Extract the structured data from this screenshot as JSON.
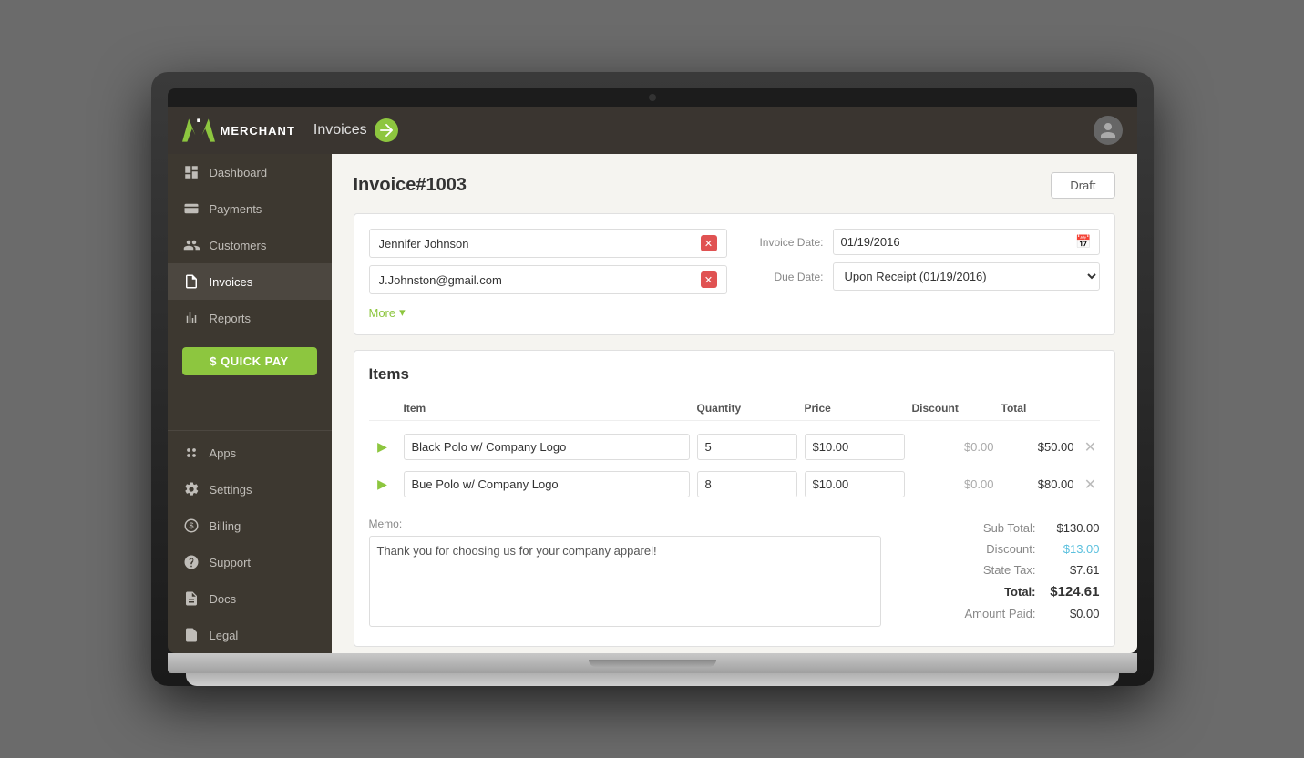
{
  "app": {
    "brand": "MERCHANT",
    "title": "Invoices"
  },
  "nav": {
    "items": [
      {
        "id": "dashboard",
        "label": "Dashboard"
      },
      {
        "id": "payments",
        "label": "Payments"
      },
      {
        "id": "customers",
        "label": "Customers"
      },
      {
        "id": "invoices",
        "label": "Invoices",
        "active": true
      },
      {
        "id": "reports",
        "label": "Reports"
      }
    ],
    "bottom_items": [
      {
        "id": "apps",
        "label": "Apps"
      },
      {
        "id": "settings",
        "label": "Settings"
      },
      {
        "id": "billing",
        "label": "Billing"
      },
      {
        "id": "support",
        "label": "Support"
      },
      {
        "id": "docs",
        "label": "Docs"
      },
      {
        "id": "legal",
        "label": "Legal"
      }
    ],
    "quick_pay_label": "$ QUICK PAY"
  },
  "invoice": {
    "title": "Invoice#1003",
    "draft_label": "Draft",
    "customer_name": "Jennifer Johnson",
    "customer_email": "J.Johnston@gmail.com",
    "invoice_date_label": "Invoice Date:",
    "invoice_date": "01/19/2016",
    "due_date_label": "Due Date:",
    "due_date": "Upon Receipt (01/19/2016)",
    "more_label": "More"
  },
  "items": {
    "section_title": "Items",
    "columns": {
      "item": "Item",
      "quantity": "Quantity",
      "price": "Price",
      "discount": "Discount",
      "total": "Total"
    },
    "rows": [
      {
        "name": "Black Polo w/ Company Logo",
        "quantity": "5",
        "price": "$10.00",
        "discount": "$0.00",
        "total": "$50.00"
      },
      {
        "name": "Bue Polo w/ Company Logo",
        "quantity": "8",
        "price": "$10.00",
        "discount": "$0.00",
        "total": "$80.00"
      }
    ]
  },
  "summary": {
    "memo_label": "Memo:",
    "memo_text": "Thank you for choosing us for your company apparel!",
    "sub_total_label": "Sub Total:",
    "sub_total": "$130.00",
    "discount_label": "Discount:",
    "discount": "$13.00",
    "state_tax_label": "State Tax:",
    "state_tax": "$7.61",
    "total_label": "Total:",
    "total": "$124.61",
    "amount_paid_label": "Amount Paid:",
    "amount_paid": "$0.00"
  }
}
